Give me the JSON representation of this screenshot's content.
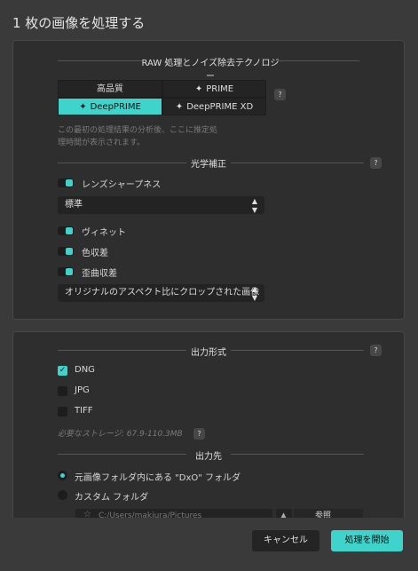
{
  "dialog": {
    "title": "1 枚の画像を処理する"
  },
  "raw": {
    "heading": "RAW 処理とノイズ除去テクノロジー",
    "options": {
      "high_quality": "高品質",
      "prime": "PRIME",
      "deepprime": "DeepPRIME",
      "deepprime_xd": "DeepPRIME XD"
    },
    "selected": "DeepPRIME",
    "hint_line1": "この最初の処理結果の分析後、ここに推定処",
    "hint_line2": "理時間が表示されます。",
    "help": "?"
  },
  "optical": {
    "heading": "光学補正",
    "help": "?",
    "lens_sharpness": "レンズシャープネス",
    "sharpness_value": "標準",
    "vignette": "ヴィネット",
    "chromatic": "色収差",
    "distortion": "歪曲収差",
    "crop_value": "オリジナルのアスペクト比にクロップされた画像"
  },
  "output_format": {
    "heading": "出力形式",
    "help": "?",
    "formats": [
      {
        "label": "DNG",
        "checked": true
      },
      {
        "label": "JPG",
        "checked": false
      },
      {
        "label": "TIFF",
        "checked": false
      }
    ],
    "storage": "必要なストレージ: 67.9-110.3MB",
    "storage_help": "?"
  },
  "destination": {
    "heading": "出力先",
    "option_source": "元画像フォルダ内にある \"DxO\" フォルダ",
    "option_custom": "カスタム フォルダ",
    "path": "C:/Users/makiura/Pictures",
    "browse": "参照"
  },
  "footer": {
    "cancel": "キャンセル",
    "start": "処理を開始"
  },
  "colors": {
    "accent": "#3ed3cb"
  }
}
